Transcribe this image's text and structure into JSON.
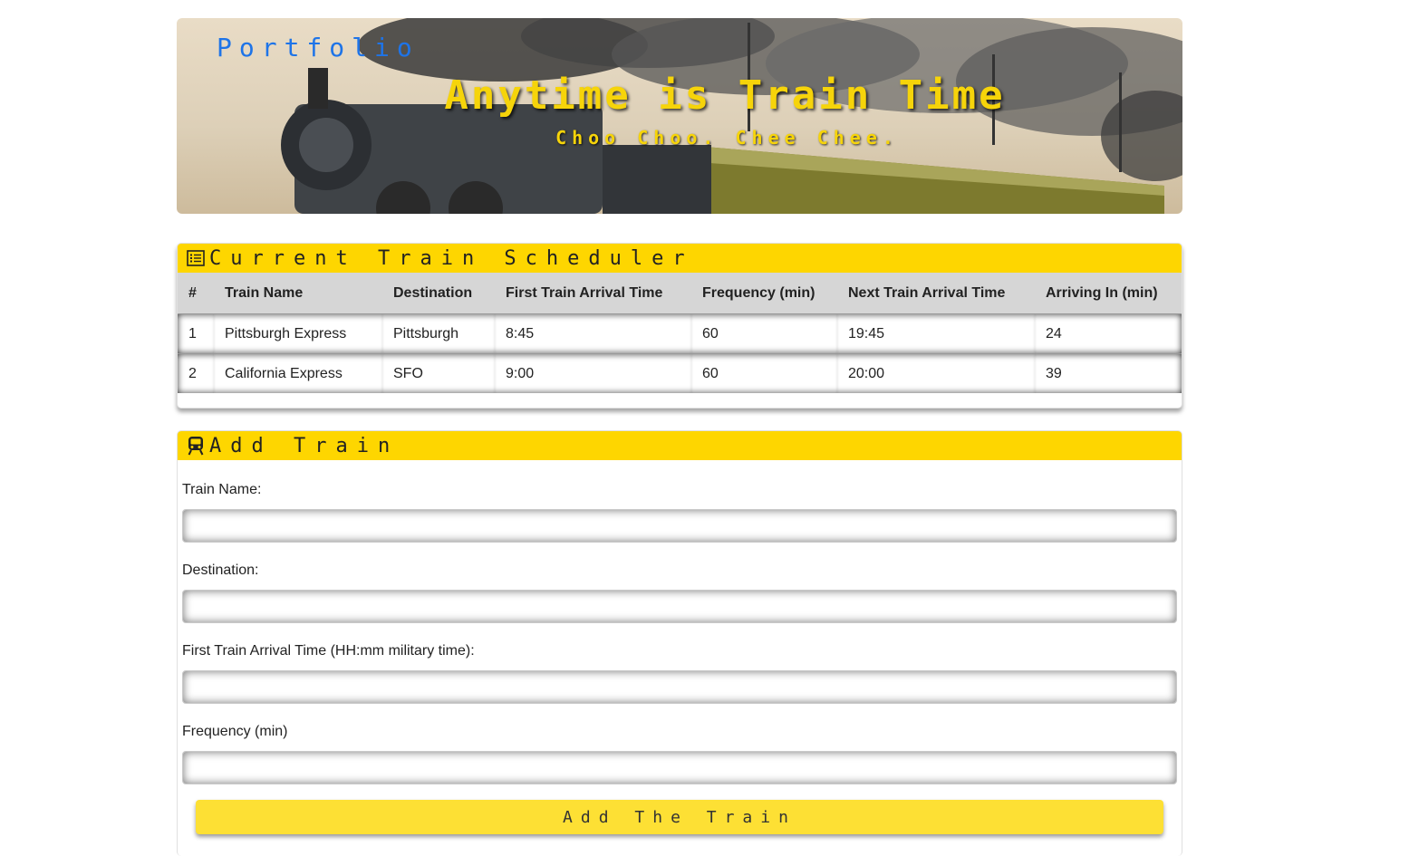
{
  "nav": {
    "portfolio_label": "Portfolio"
  },
  "hero": {
    "title": "Anytime is Train Time",
    "subtitle": "Choo Choo. Chee Chee."
  },
  "schedule": {
    "heading": "Current Train Scheduler",
    "columns": [
      "#",
      "Train Name",
      "Destination",
      "First Train Arrival Time",
      "Frequency (min)",
      "Next Train Arrival Time",
      "Arriving In (min)"
    ],
    "rows": [
      [
        "1",
        "Pittsburgh Express",
        "Pittsburgh",
        "8:45",
        "60",
        "19:45",
        "24"
      ],
      [
        "2",
        "California Express",
        "SFO",
        "9:00",
        "60",
        "20:00",
        "39"
      ]
    ]
  },
  "add_train": {
    "heading": "Add Train",
    "fields": {
      "name_label": "Train Name:",
      "destination_label": "Destination:",
      "first_time_label": "First Train Arrival Time (HH:mm military time):",
      "frequency_label": "Frequency (min)"
    },
    "submit_label": "Add The Train"
  },
  "colors": {
    "accent_yellow": "#fed600",
    "button_yellow": "#fde034",
    "link_blue": "#1e74e8"
  }
}
